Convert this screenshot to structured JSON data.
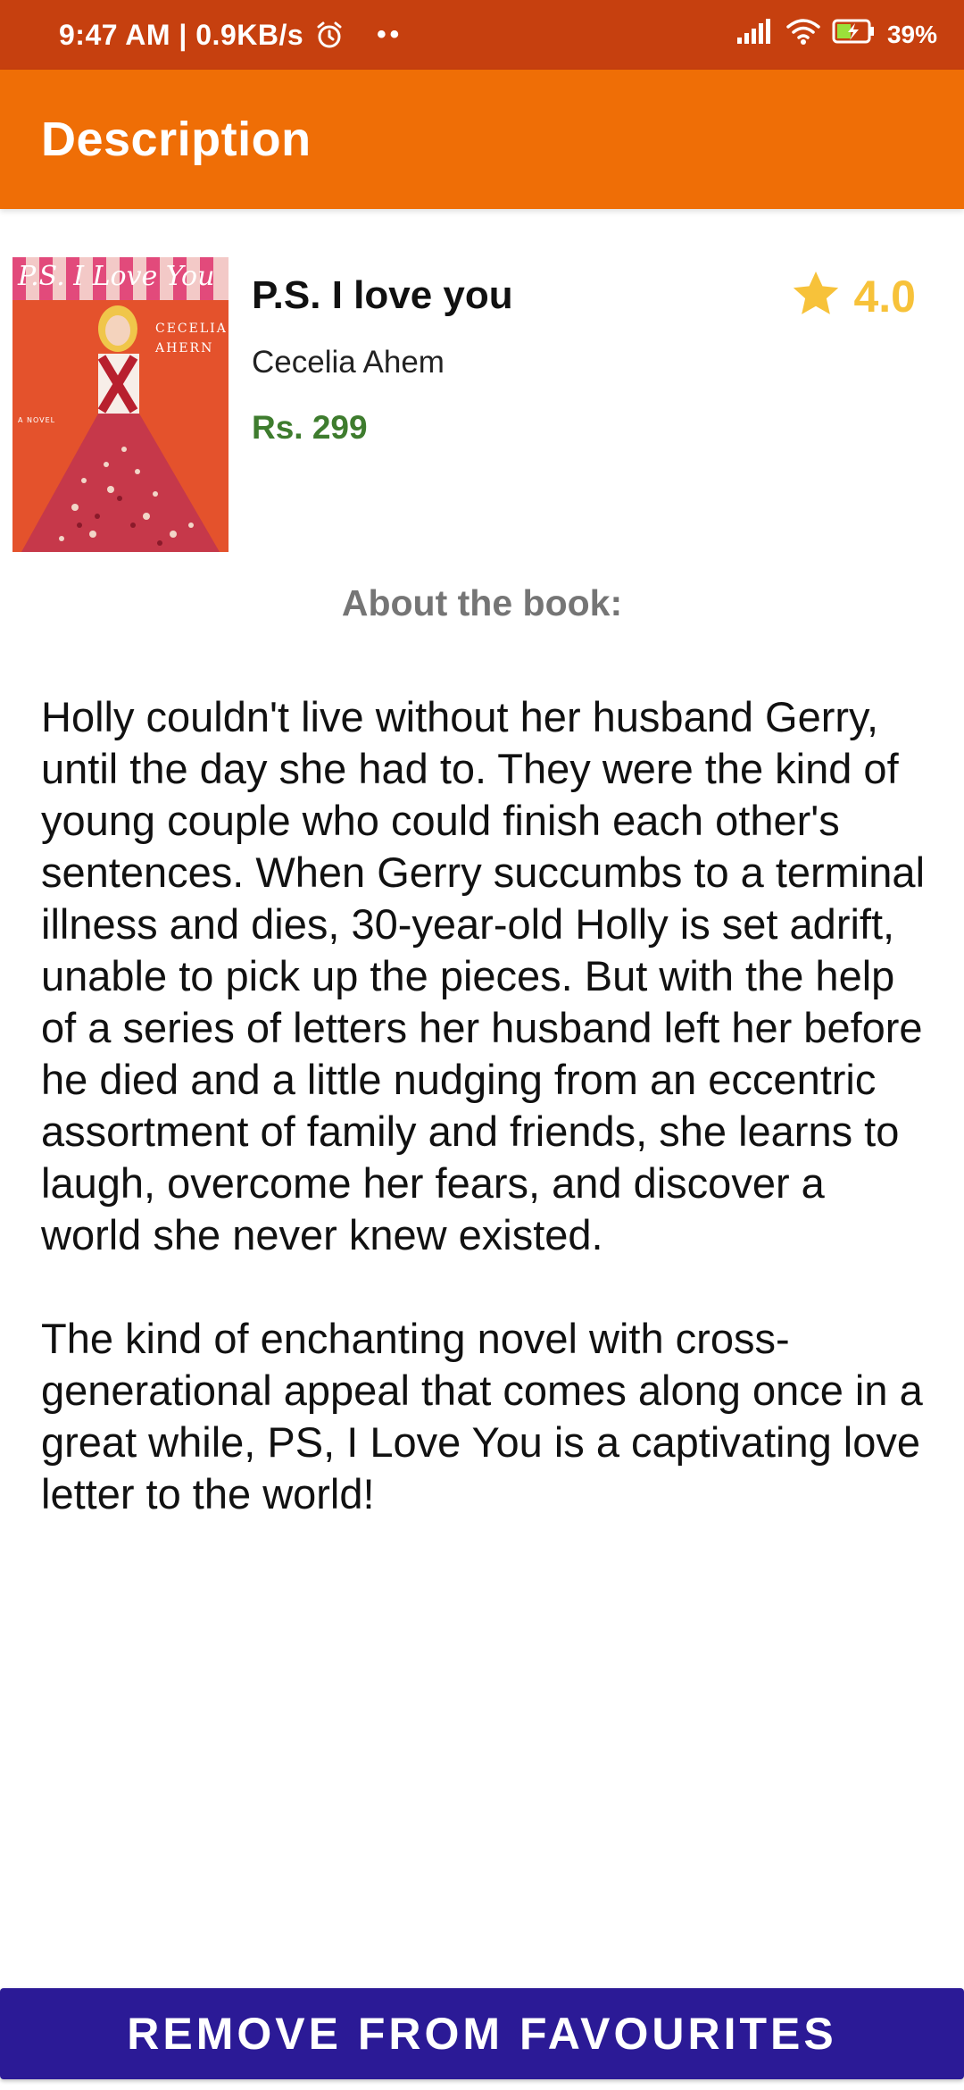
{
  "status_bar": {
    "time": "9:47 AM",
    "speed": "0.9KB/s",
    "dots": "••",
    "battery": "39%"
  },
  "app_bar": {
    "title": "Description"
  },
  "book": {
    "cover_title": "P.S. I Love You",
    "cover_author_line1": "Cecelia",
    "cover_author_line2": "Ahern",
    "cover_tag": "A NOVEL",
    "title": "P.S. I love you",
    "author": "Cecelia Ahem",
    "price": "Rs. 299",
    "rating": "4.0"
  },
  "about": {
    "heading": "About the book:",
    "paragraphs": [
      "Holly couldn't live without her husband Gerry, until the day she had to. They were the kind of young couple who could finish each other's sentences. When Gerry succumbs to a terminal illness and dies, 30-year-old Holly is set adrift, unable to pick up the pieces. But with the help of a series of letters her husband left her before he died and a little nudging from an eccentric assortment of family and friends, she learns to laugh, overcome her fears, and discover a world she never knew existed.",
      "The kind of enchanting novel with cross-generational appeal that comes along once in a great while, PS, I Love You is a captivating love letter to the world!"
    ]
  },
  "action": {
    "label": "REMOVE FROM FAVOURITES"
  },
  "colors": {
    "status_bar": "#c6400f",
    "app_bar": "#ef6e06",
    "price": "#3e7c2e",
    "rating": "#f7c23a",
    "button": "#2b1a96"
  }
}
